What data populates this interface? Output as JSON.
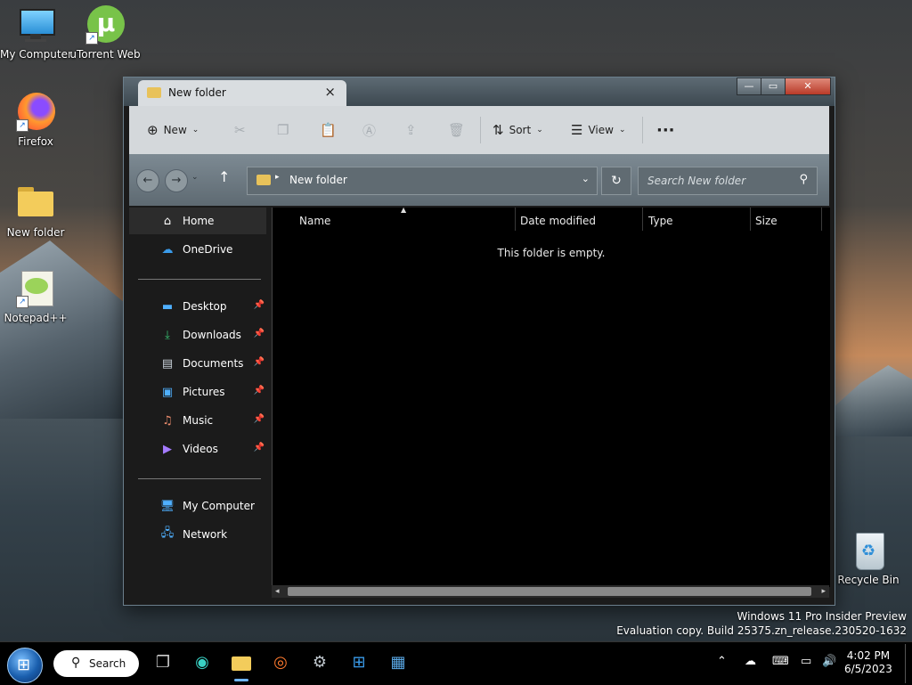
{
  "desktop": {
    "icons": [
      {
        "label": "My Computer"
      },
      {
        "label": "uTorrent Web"
      },
      {
        "label": "Firefox"
      },
      {
        "label": "New folder"
      },
      {
        "label": "Notepad++"
      },
      {
        "label": "Recycle Bin"
      }
    ],
    "watermark": {
      "line1": "Windows 11 Pro Insider Preview",
      "line2": "Evaluation copy. Build 25375.zn_release.230520-1632"
    }
  },
  "explorer": {
    "tab_title": "New folder",
    "toolbar": {
      "new_label": "New",
      "sort_label": "Sort",
      "view_label": "View",
      "more_label": "···"
    },
    "address": {
      "path": "New folder",
      "search_placeholder": "Search New folder"
    },
    "nav": {
      "home": "Home",
      "onedrive": "OneDrive",
      "quick_access": [
        "Desktop",
        "Downloads",
        "Documents",
        "Pictures",
        "Music",
        "Videos"
      ],
      "my_computer": "My Computer",
      "network": "Network"
    },
    "columns": [
      "Name",
      "Date modified",
      "Type",
      "Size"
    ],
    "empty_message": "This folder is empty."
  },
  "taskbar": {
    "search_label": "Search",
    "time": "4:02 PM",
    "date": "6/5/2023"
  },
  "colors": {
    "accent": "#6fb6ff",
    "toolbar_bg": "#d4d8db",
    "folder_yellow": "#e8c25a"
  }
}
